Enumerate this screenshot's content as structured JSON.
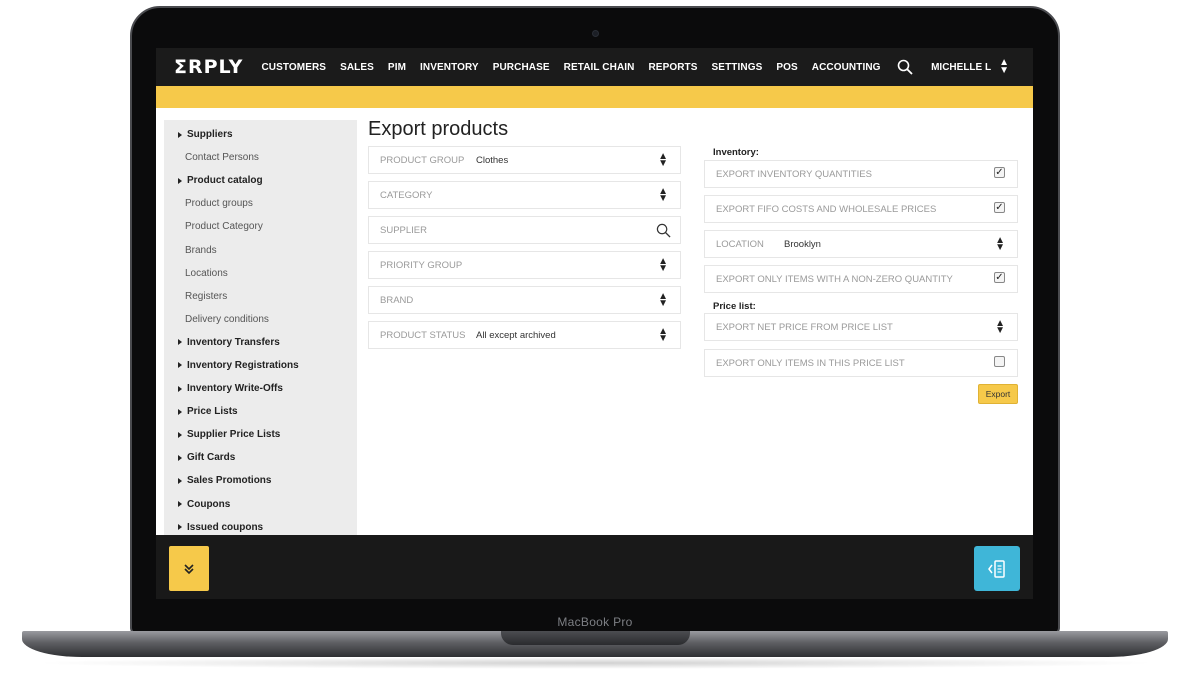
{
  "device": {
    "bezel_label": "MacBook Pro"
  },
  "nav": {
    "logo": "ΣRPLY",
    "items": [
      "CUSTOMERS",
      "SALES",
      "PIM",
      "INVENTORY",
      "PURCHASE",
      "RETAIL CHAIN",
      "REPORTS",
      "SETTINGS",
      "POS",
      "ACCOUNTING"
    ],
    "search_icon": "search-icon",
    "user": "MICHELLE L"
  },
  "sidebar": {
    "items": [
      {
        "label": "Suppliers",
        "type": "section"
      },
      {
        "label": "Contact Persons",
        "type": "sub"
      },
      {
        "label": "Product catalog",
        "type": "section"
      },
      {
        "label": "Product groups",
        "type": "sub"
      },
      {
        "label": "Product Category",
        "type": "sub"
      },
      {
        "label": "Brands",
        "type": "sub"
      },
      {
        "label": "Locations",
        "type": "sub"
      },
      {
        "label": "Registers",
        "type": "sub"
      },
      {
        "label": "Delivery conditions",
        "type": "sub"
      },
      {
        "label": "Inventory Transfers",
        "type": "section"
      },
      {
        "label": "Inventory Registrations",
        "type": "section"
      },
      {
        "label": "Inventory Write-Offs",
        "type": "section"
      },
      {
        "label": "Price Lists",
        "type": "section"
      },
      {
        "label": "Supplier Price Lists",
        "type": "section"
      },
      {
        "label": "Gift Cards",
        "type": "section"
      },
      {
        "label": "Sales Promotions",
        "type": "section"
      },
      {
        "label": "Coupons",
        "type": "section"
      },
      {
        "label": "Issued coupons",
        "type": "section"
      }
    ]
  },
  "main": {
    "title": "Export products",
    "left_fields": [
      {
        "label": "PRODUCT GROUP",
        "value": "Clothes",
        "control": "select"
      },
      {
        "label": "CATEGORY",
        "value": "",
        "control": "select"
      },
      {
        "label": "SUPPLIER",
        "value": "",
        "control": "search"
      },
      {
        "label": "PRIORITY GROUP",
        "value": "",
        "control": "select"
      },
      {
        "label": "BRAND",
        "value": "",
        "control": "select"
      },
      {
        "label": "PRODUCT STATUS",
        "value": "All except archived",
        "control": "select"
      }
    ],
    "inventory_label": "Inventory:",
    "inventory_fields": [
      {
        "label": "EXPORT INVENTORY QUANTITIES",
        "control": "checkbox",
        "checked": true
      },
      {
        "label": "EXPORT FIFO COSTS AND WHOLESALE PRICES",
        "control": "checkbox",
        "checked": true
      },
      {
        "label": "LOCATION",
        "value": "Brooklyn",
        "control": "select"
      },
      {
        "label": "EXPORT ONLY ITEMS WITH A NON-ZERO QUANTITY",
        "control": "checkbox",
        "checked": true
      }
    ],
    "price_list_label": "Price list:",
    "price_fields": [
      {
        "label": "EXPORT NET PRICE FROM PRICE LIST",
        "control": "select"
      },
      {
        "label": "EXPORT ONLY ITEMS IN THIS PRICE LIST",
        "control": "checkbox",
        "checked": false
      }
    ],
    "export_button": "Export"
  },
  "bottom": {
    "left_button_icon": "double-chevron-down-icon",
    "right_button_icon": "collapse-panel-icon"
  },
  "colors": {
    "accent_yellow": "#f6c94a",
    "nav_bg": "#1b1b1b",
    "blue_button": "#3fb6d8"
  }
}
